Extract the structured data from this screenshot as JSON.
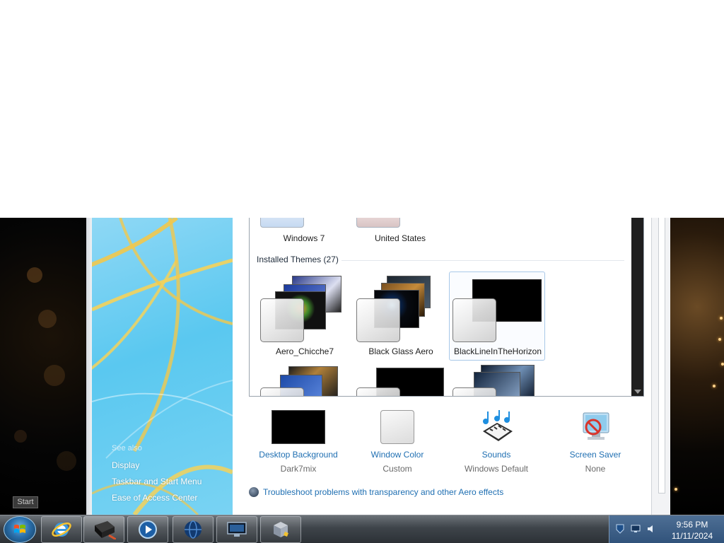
{
  "theme_list": {
    "top_row": [
      {
        "caption": "Windows 7"
      },
      {
        "caption": "United States"
      }
    ],
    "section_title": "Installed Themes (27)",
    "themes": [
      {
        "caption": "Aero_Chicche7"
      },
      {
        "caption": "Black Glass Aero"
      },
      {
        "caption": "BlackLineInTheHorizon",
        "selected": true
      }
    ]
  },
  "settings": [
    {
      "label": "Desktop Background",
      "value": "Dark7mix",
      "icon": "black-wallpaper-icon"
    },
    {
      "label": "Window Color",
      "value": "Custom",
      "icon": "window-color-swatch-icon"
    },
    {
      "label": "Sounds",
      "value": "Windows Default",
      "icon": "music-notes-keyboard-icon"
    },
    {
      "label": "Screen Saver",
      "value": "None",
      "icon": "screen-saver-no-icon"
    }
  ],
  "troubleshoot_link": "Troubleshoot problems with transparency and other Aero effects",
  "nav": {
    "see_also": "See also",
    "links": [
      "Display",
      "Taskbar and Start Menu",
      "Ease of Access Center"
    ]
  },
  "start_tooltip": "Start",
  "taskbar": {
    "buttons": [
      {
        "name": "internet-explorer",
        "icon": "ie-icon"
      },
      {
        "name": "personalization",
        "icon": "personalization-icon",
        "active": true
      },
      {
        "name": "media-player",
        "icon": "media-player-icon"
      },
      {
        "name": "globe",
        "icon": "globe-icon"
      },
      {
        "name": "display",
        "icon": "monitor-icon"
      },
      {
        "name": "virtualbox",
        "icon": "virtualbox-icon"
      }
    ],
    "clock": {
      "time": "9:56 PM",
      "date": "11/11/2024"
    }
  },
  "colors": {
    "link": "#1f6fb2",
    "nav_gradient": "#5ac8f0",
    "taskbar": "#3e444a",
    "tray": "#30527a"
  }
}
